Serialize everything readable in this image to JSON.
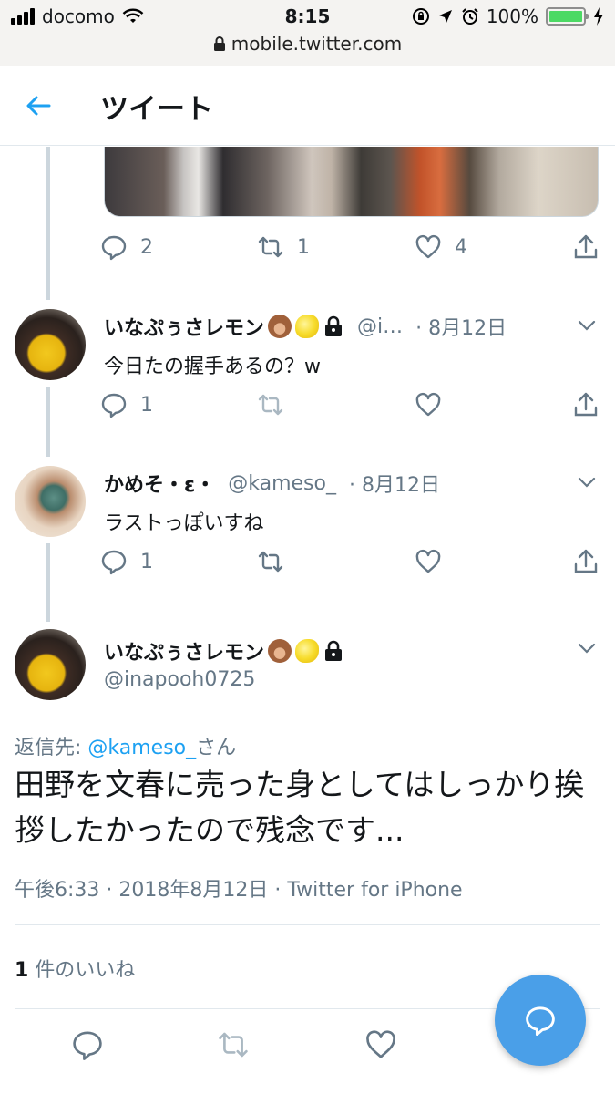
{
  "status_bar": {
    "carrier": "docomo",
    "time": "8:15",
    "battery": "100%",
    "battery_level": 1.0,
    "url": "mobile.twitter.com"
  },
  "header": {
    "title": "ツイート"
  },
  "thread": [
    {
      "replies": "2",
      "retweets": "1",
      "likes": "4"
    },
    {
      "name": "いなぷぅさレモン",
      "handle": "@i…",
      "date": "· 8月12日",
      "text": "今日たの握手あるの？w",
      "replies": "1",
      "retweets": "",
      "likes": ""
    },
    {
      "name": "かめそ・ε・",
      "handle": "@kameso_",
      "date": "· 8月12日",
      "text": "ラストっぽいすね",
      "replies": "1",
      "retweets": "",
      "likes": ""
    }
  ],
  "main_tweet": {
    "name": "いなぷぅさレモン",
    "handle": "@inapooh0725",
    "reply_prefix": "返信先: ",
    "reply_mention": "@kameso_",
    "reply_suffix": "さん",
    "text": "田野を文春に売った身としてはしっかり挨拶したかったので残念です...",
    "timestamp": "午後6:33 · 2018年8月12日 · Twitter for iPhone",
    "likes_count": "1",
    "likes_label": " 件のいいね"
  },
  "colors": {
    "accent": "#1da1f2",
    "fab": "#4a9fe8",
    "muted": "#657786",
    "battery": "#4cd964"
  }
}
